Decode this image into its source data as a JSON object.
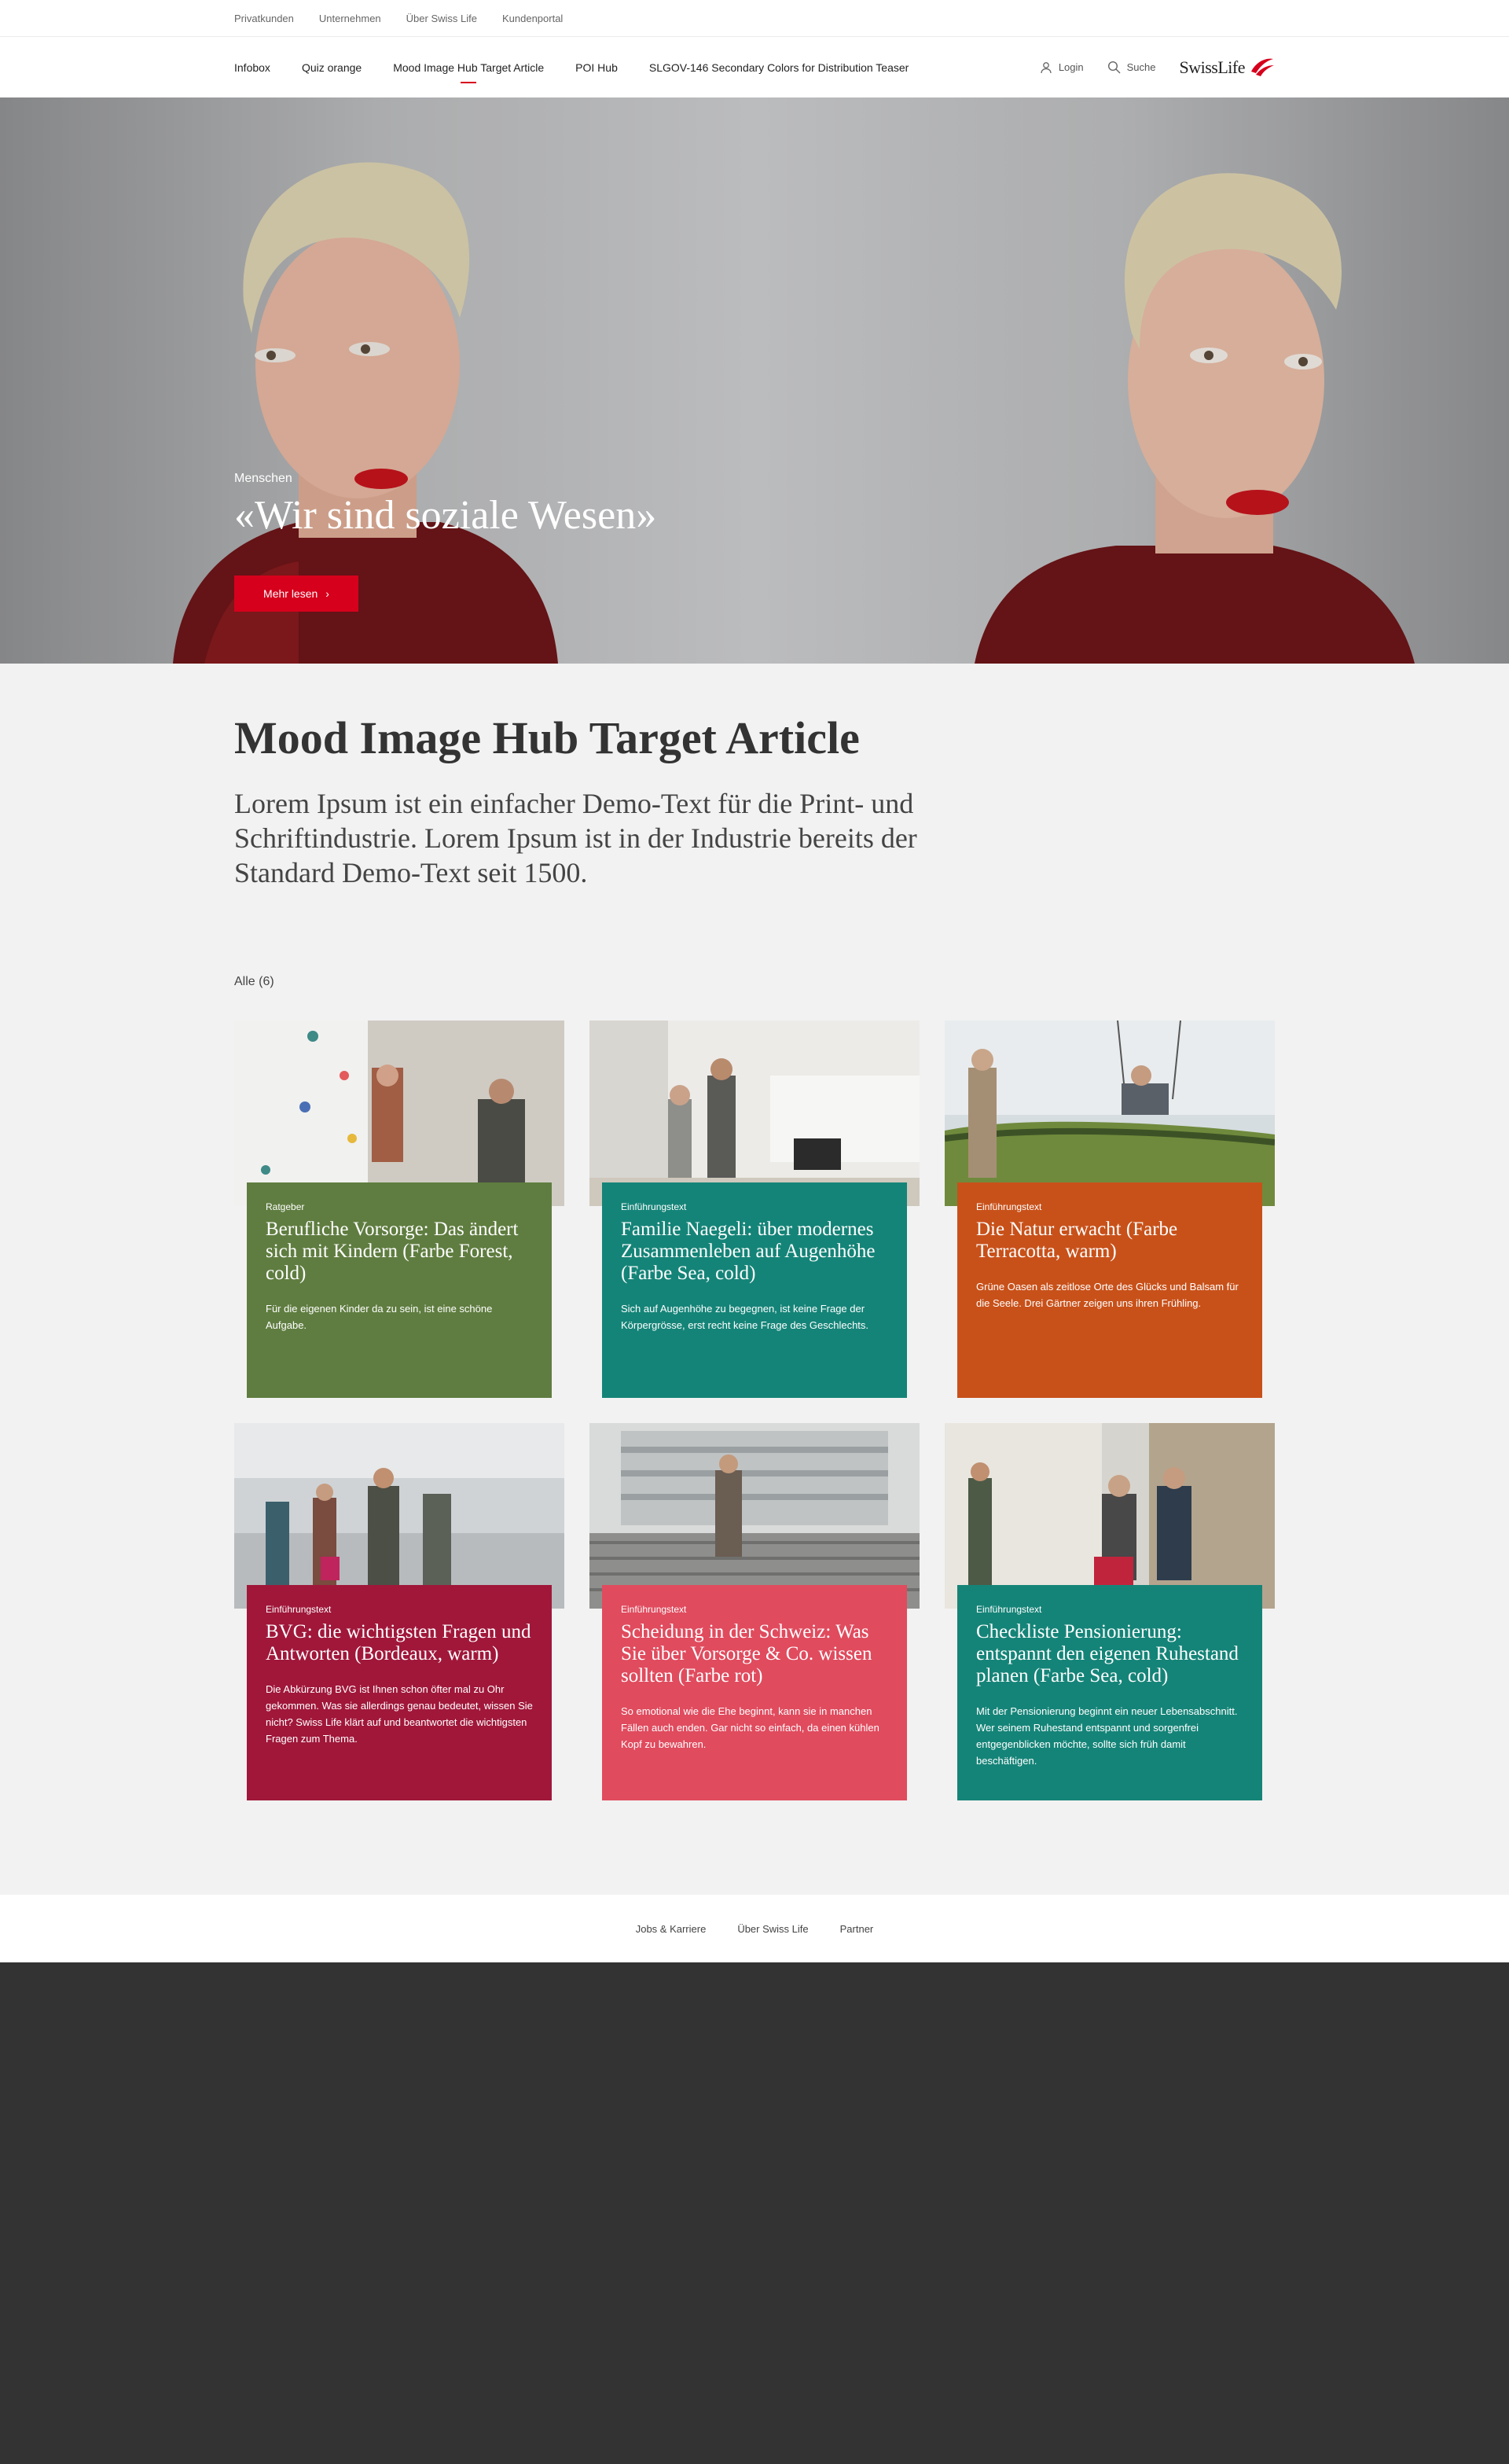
{
  "meta_nav": [
    "Privatkunden",
    "Unternehmen",
    "Über Swiss Life",
    "Kundenportal"
  ],
  "main_nav": [
    {
      "label": "Infobox",
      "active": false
    },
    {
      "label": "Quiz orange",
      "active": false
    },
    {
      "label": "Mood Image Hub Target Article",
      "active": true
    },
    {
      "label": "POI Hub",
      "active": false
    },
    {
      "label": "SLGOV-146 Secondary Colors for Distribution Teaser",
      "active": false
    }
  ],
  "utility": {
    "login": "Login",
    "search": "Suche"
  },
  "logo": {
    "text": "SwissLife",
    "color": "#d6001c"
  },
  "hero": {
    "eyebrow": "Menschen",
    "title": "«Wir sind soziale Wesen»",
    "cta": "Mehr lesen"
  },
  "intro": {
    "title": "Mood Image Hub Target Article",
    "lead": "Lorem Ipsum ist ein einfacher Demo-Text für die Print- und Schriftindustrie. Lorem Ipsum ist in der Industrie bereits der Standard Demo-Text seit 1500."
  },
  "filter": "Alle (6)",
  "cards": [
    {
      "category": "Ratgeber",
      "title": "Berufliche Vorsorge: Das ändert sich mit Kindern (Farbe Forest, cold)",
      "text": "Für die eigenen Kinder da zu sein, ist eine schöne Aufgabe.",
      "color": "#5f7d40",
      "image": "climbing-wall"
    },
    {
      "category": "Einführungstext",
      "title": "Familie Naegeli: über modernes Zusammenleben auf Augenhöhe (Farbe Sea, cold)",
      "text": "Sich auf Augenhöhe zu begegnen, ist keine Frage der Körpergrösse, erst recht keine Frage des Geschlechts.",
      "color": "#158478",
      "image": "family-living-room"
    },
    {
      "category": "Einführungstext",
      "title": "Die Natur erwacht (Farbe Terracotta, warm)",
      "text": "Grüne Oasen als zeitlose Orte des Glücks und Balsam für die Seele. Drei Gärtner zeigen uns ihren Frühling.",
      "color": "#c8511a",
      "image": "swing-meadow"
    },
    {
      "category": "Einführungstext",
      "title": "BVG: die wichtigsten Fragen und Antworten (Bordeaux, warm)",
      "text": "Die Abkürzung BVG ist Ihnen schon öfter mal zu Ohr gekommen. Was sie allerdings genau bedeutet, wissen Sie nicht? Swiss Life klärt auf und beantwortet die wichtigsten Fragen zum Thema.",
      "color": "#a0173a",
      "image": "airport-travelers"
    },
    {
      "category": "Einführungstext",
      "title": "Scheidung in der Schweiz: Was Sie über Vorsorge & Co. wissen sollten (Farbe rot)",
      "text": "So emotional wie die Ehe beginnt, kann sie in manchen Fällen auch enden. Gar nicht so einfach, da einen kühlen Kopf zu bewahren.",
      "color": "#e04b5e",
      "image": "stairs-building"
    },
    {
      "category": "Einführungstext",
      "title": "Checkliste Pensionierung: entspannt den eigenen Ruhestand planen (Farbe Sea, cold)",
      "text": "Mit der Pensionierung beginnt ein neuer Lebensabschnitt. Wer seinem Ruhestand entspannt und sorgenfrei entgegenblicken möchte, sollte sich früh damit beschäftigen.",
      "color": "#158478",
      "image": "bench-couple"
    }
  ],
  "footer_links": [
    "Jobs & Karriere",
    "Über Swiss Life",
    "Partner"
  ]
}
